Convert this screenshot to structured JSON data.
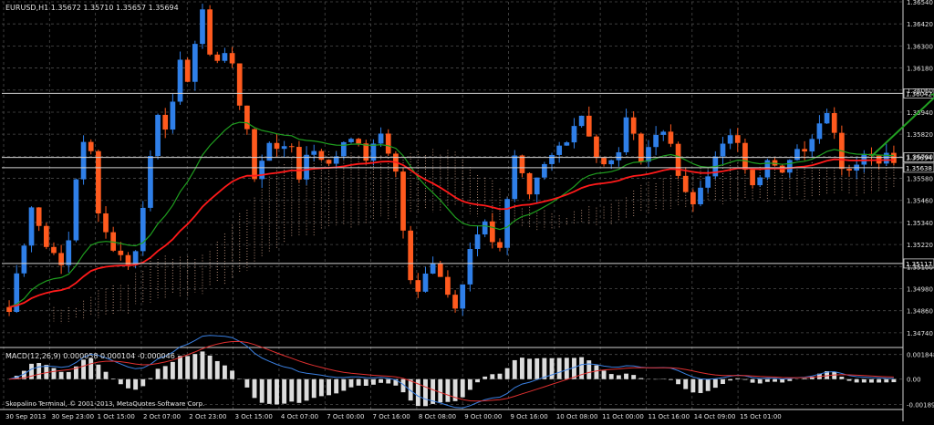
{
  "header": {
    "symbol_line": "EURUSD,H1  1.35672 1.35710 1.35657 1.35694"
  },
  "macd_header": "MACD(12,26,9) 0.000058 0.000104 -0.000046",
  "copyright": "Skopalino Terminal, © 2001-2013, MetaQuotes Software Corp.",
  "colors": {
    "background": "#000000",
    "grid": "#4a4a4a",
    "bull_candle": "#2f7fe8",
    "bear_candle": "#ff5a1e",
    "ma_fast": "#1f9e1f",
    "ma_slow": "#ff1a1a",
    "cloud": "#e8b59a",
    "macd_line": "#3a7fe0",
    "signal_line": "#e03030",
    "histogram": "#dcdcdc",
    "arrow": "#22a022"
  },
  "chart_data": {
    "type": "candlestick",
    "price_axis": {
      "ylim": [
        1.3468,
        1.3654
      ],
      "ticks": [
        "1.36540",
        "1.36420",
        "1.36300",
        "1.36180",
        "1.36060",
        "1.35940",
        "1.35820",
        "1.35700",
        "1.35580",
        "1.35460",
        "1.35340",
        "1.35220",
        "1.35100",
        "1.34980",
        "1.34860",
        "1.34740"
      ],
      "tick_values": [
        1.3654,
        1.3642,
        1.363,
        1.3618,
        1.3606,
        1.3594,
        1.3582,
        1.357,
        1.3558,
        1.3546,
        1.3534,
        1.3522,
        1.351,
        1.3498,
        1.3486,
        1.3474
      ]
    },
    "x_axis": {
      "labels": [
        "30 Sep 2013",
        "30 Sep 23:00",
        "1 Oct 15:00",
        "2 Oct 07:00",
        "2 Oct 23:00",
        "3 Oct 15:00",
        "4 Oct 07:00",
        "7 Oct 00:00",
        "7 Oct 16:00",
        "8 Oct 08:00",
        "9 Oct 00:00",
        "9 Oct 16:00",
        "10 Oct 08:00",
        "11 Oct 00:00",
        "11 Oct 16:00",
        "14 Oct 09:00",
        "15 Oct 01:00"
      ]
    },
    "bars_visible": 120,
    "price_path": [
      1.3488,
      1.3506,
      1.3522,
      1.3545,
      1.353,
      1.3522,
      1.3516,
      1.351,
      1.3525,
      1.3558,
      1.358,
      1.357,
      1.354,
      1.3528,
      1.352,
      1.3515,
      1.3512,
      1.3518,
      1.354,
      1.357,
      1.3595,
      1.3582,
      1.36,
      1.3625,
      1.3612,
      1.3632,
      1.3648,
      1.3628,
      1.3622,
      1.3626,
      1.362,
      1.36,
      1.3585,
      1.356,
      1.3568,
      1.3575,
      1.3572,
      1.3574,
      1.3578,
      1.356,
      1.3572,
      1.3575,
      1.3571,
      1.3567,
      1.357,
      1.3575,
      1.3582,
      1.3578,
      1.357,
      1.3575,
      1.358,
      1.357,
      1.356,
      1.353,
      1.3505,
      1.3498,
      1.3508,
      1.3512,
      1.3505,
      1.3495,
      1.349,
      1.35,
      1.352,
      1.353,
      1.3532,
      1.3524,
      1.3518,
      1.3545,
      1.357,
      1.356,
      1.355,
      1.356,
      1.3565,
      1.3568,
      1.3575,
      1.358,
      1.3585,
      1.3595,
      1.3582,
      1.3572,
      1.3565,
      1.3568,
      1.3575,
      1.359,
      1.358,
      1.357,
      1.3575,
      1.358,
      1.3585,
      1.3578,
      1.356,
      1.3548,
      1.3545,
      1.355,
      1.356,
      1.3568,
      1.3575,
      1.358,
      1.358,
      1.3565,
      1.3555,
      1.356,
      1.357,
      1.3565,
      1.356,
      1.357,
      1.3575,
      1.3572,
      1.358,
      1.359,
      1.3595,
      1.3585,
      1.3565,
      1.356,
      1.3565,
      1.357,
      1.3569,
      1.3569,
      1.3569,
      1.3569
    ],
    "horizontal_levels": [
      {
        "value": 1.36042,
        "label": "1.36042"
      },
      {
        "value": 1.35694,
        "label": "1.35694"
      },
      {
        "value": 1.35638,
        "label": "1.35638"
      },
      {
        "value": 1.35117,
        "label": "1.35117"
      }
    ],
    "macd": {
      "ticks": [
        "0.001848",
        "0.00",
        "-0.001891"
      ],
      "tick_values": [
        0.001848,
        0.0,
        -0.001891
      ],
      "ylim": [
        -0.002,
        0.0021
      ]
    }
  }
}
